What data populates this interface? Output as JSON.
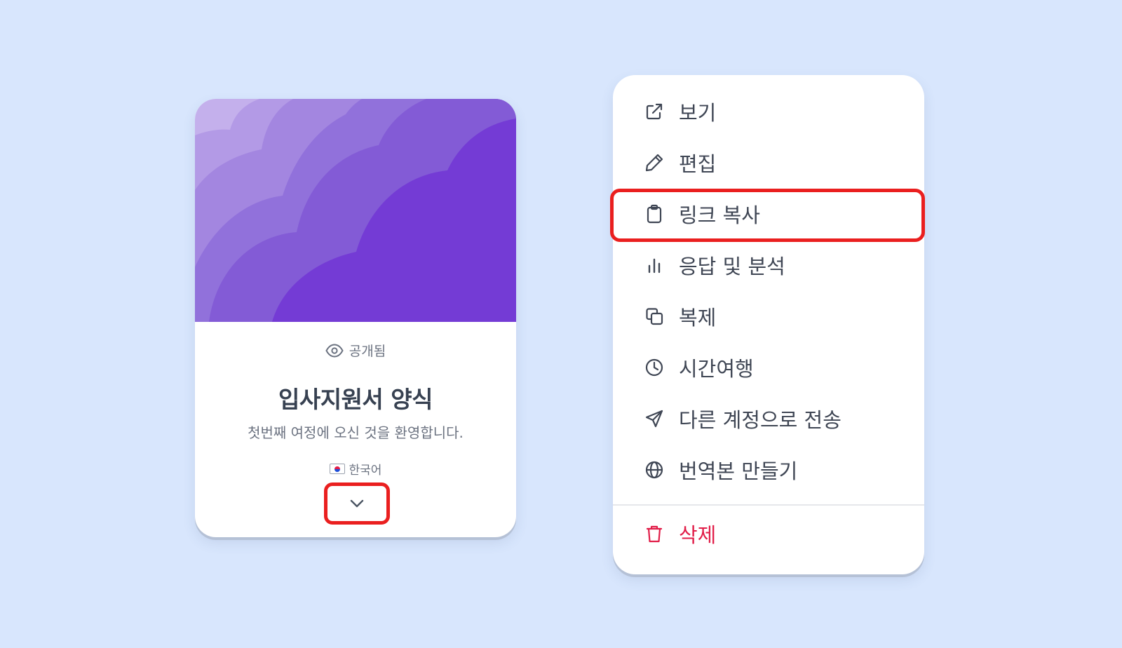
{
  "card": {
    "status_label": "공개됨",
    "title": "입사지원서 양식",
    "description": "첫번째 여정에 오신 것을 환영합니다.",
    "language": "한국어",
    "cover_colors": [
      "#c4b0ec",
      "#b39ae6",
      "#a386e0",
      "#9171db",
      "#835bd6",
      "#743bd5"
    ]
  },
  "menu": {
    "items": [
      {
        "label": "보기",
        "icon": "external-link-icon"
      },
      {
        "label": "편집",
        "icon": "pencil-icon"
      },
      {
        "label": "링크 복사",
        "icon": "clipboard-icon"
      },
      {
        "label": "응답 및 분석",
        "icon": "bar-chart-icon"
      },
      {
        "label": "복제",
        "icon": "duplicate-icon"
      },
      {
        "label": "시간여행",
        "icon": "clock-icon"
      },
      {
        "label": "다른 계정으로 전송",
        "icon": "send-icon"
      },
      {
        "label": "번역본 만들기",
        "icon": "globe-icon"
      }
    ],
    "delete_label": "삭제"
  },
  "colors": {
    "background": "#d8e6fd",
    "highlight": "#ea1f1f",
    "danger": "#e11d48",
    "cover_dark": "#743bd5"
  }
}
